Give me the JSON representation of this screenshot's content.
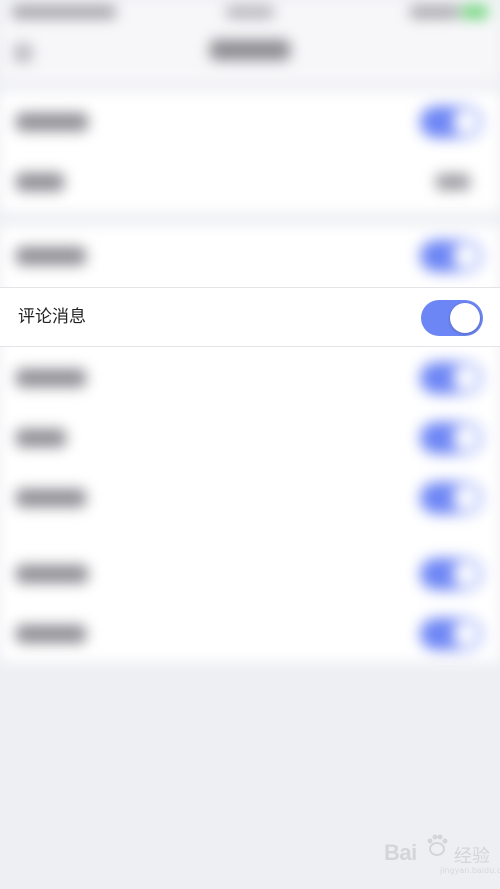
{
  "settings": {
    "comment_message": {
      "label": "评论消息",
      "enabled": true,
      "accent_color": "#6d86f6"
    }
  },
  "watermark": {
    "brand": "Bai",
    "sub": "经验",
    "url": "jingyan.baidu.com"
  }
}
